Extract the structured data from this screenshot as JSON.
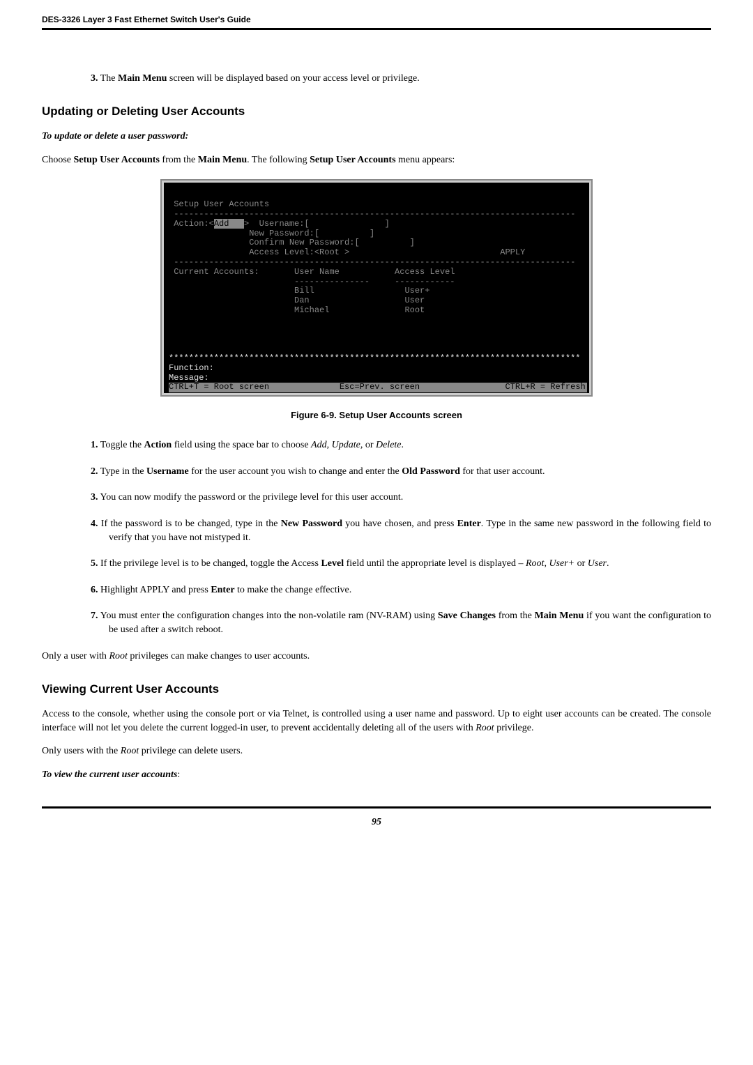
{
  "header": {
    "title": "DES-3326 Layer 3 Fast Ethernet Switch User's Guide"
  },
  "step3_top": {
    "num": "3.",
    "text_a": "The ",
    "bold": "Main Menu",
    "text_b": " screen will be displayed based on your access level or privilege."
  },
  "sec_update": {
    "heading": "Updating or Deleting User Accounts",
    "subheading": "To update or delete a user password:",
    "intro_a": "Choose ",
    "intro_b1": "Setup User Accounts",
    "intro_c": " from the ",
    "intro_b2": "Main Menu",
    "intro_d": ". The following ",
    "intro_b3": "Setup User Accounts",
    "intro_e": " menu appears:"
  },
  "terminal": {
    "title": " Setup User Accounts",
    "dash1": " --------------------------------------------------------------------------------",
    "l1a": " Action:<",
    "l1sel": "Add   ",
    "l1b": ">  Username:[               ]",
    "l2": "                New Password:[          ]",
    "l3": "                Confirm New Password:[          ]",
    "l4a": "                Access Level:<Root >                              ",
    "l4apply": "APPLY",
    "dash2": " --------------------------------------------------------------------------------",
    "hdr": " Current Accounts:       User Name           Access Level",
    "hdr2": "                         ---------------     ------------",
    "r1": "                         Bill                  User+",
    "r2": "                         Dan                   User",
    "r3": "                         Michael               Root",
    "blank": " ",
    "sep": "**********************************************************************************",
    "fn": "Function:",
    "msg": "Message:",
    "status_a": "CTRL+T = Root screen",
    "status_b": "Esc=Prev. screen",
    "status_c": "CTRL+R = Refresh"
  },
  "fig_caption": "Figure 6-9.  Setup User Accounts screen",
  "steps": [
    {
      "num": "1.",
      "a": "Toggle the ",
      "b1": "Action",
      "b": " field using the space bar to choose ",
      "i1": "Add",
      "c": ", ",
      "i2": "Update",
      "d": ", or ",
      "i3": "Delete",
      "e": "."
    },
    {
      "num": "2.",
      "a": "Type in the ",
      "b1": "Username",
      "b": " for the user account you wish to change and enter the ",
      "b2": "Old Password",
      "c": " for that user account."
    },
    {
      "num": "3.",
      "a": "You can now modify the password or the privilege level for this user account."
    },
    {
      "num": "4.",
      "a": "If the password is to be changed, type in the ",
      "b1": "New Password",
      "b": " you have chosen, and press ",
      "b2": "Enter",
      "c": ". Type in the same new password in the following field to verify that you have not mistyped it."
    },
    {
      "num": "5.",
      "a": "If the privilege level is to be changed, toggle the Access ",
      "b1": "Level",
      "b": " field until the appropriate level is displayed – ",
      "i1": "Root",
      "c": ", ",
      "i2": "User+",
      "d": " or ",
      "i3": "User",
      "e": "."
    },
    {
      "num": "6.",
      "a": "Highlight APPLY and press ",
      "b1": "Enter",
      "b": " to make the change effective."
    },
    {
      "num": "7.",
      "a": "You must enter the configuration changes into the non-volatile ram (NV-RAM) using ",
      "b1": "Save Changes",
      "b": " from the ",
      "b2": "Main Menu",
      "c": " if you want the configuration to be used after a switch reboot."
    }
  ],
  "after_steps": "Only a user with Root privileges can make changes to user accounts.",
  "after_steps_i": "Root",
  "after_steps_pre": "Only a user with ",
  "after_steps_post": " privileges can make changes to user accounts.",
  "sec_view": {
    "heading": "Viewing Current User Accounts",
    "p1_a": "Access to the console, whether using the console port or via Telnet, is controlled using a user name and password. Up to eight user accounts can be created. The console interface will not let you delete the current logged-in user, to prevent accidentally deleting all of the users with ",
    "p1_i": "Root",
    "p1_b": " privilege.",
    "p2_a": "Only users with the ",
    "p2_i": "Root",
    "p2_b": " privilege can delete users.",
    "sub": "To view the current user accounts",
    "sub_colon": ":"
  },
  "footer": {
    "page": "95"
  }
}
